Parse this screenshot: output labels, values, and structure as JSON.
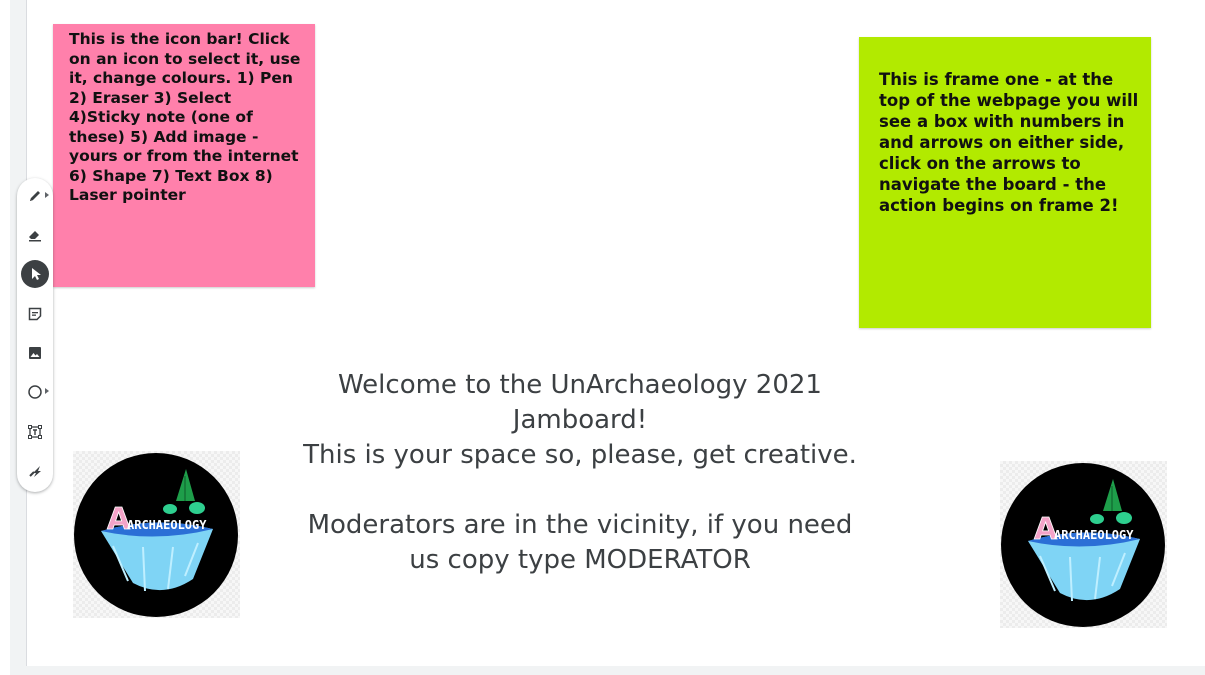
{
  "toolbar": {
    "tools": [
      {
        "name": "pen",
        "icon": "pen-icon"
      },
      {
        "name": "eraser",
        "icon": "eraser-icon"
      },
      {
        "name": "select",
        "icon": "select-cursor-icon",
        "active": true
      },
      {
        "name": "sticky-note",
        "icon": "sticky-note-icon"
      },
      {
        "name": "add-image",
        "icon": "image-icon"
      },
      {
        "name": "shape",
        "icon": "circle-shape-icon"
      },
      {
        "name": "text-box",
        "icon": "text-box-icon"
      },
      {
        "name": "laser-pointer",
        "icon": "laser-pointer-icon"
      }
    ]
  },
  "notes": {
    "icon_bar": "This is the icon bar! Click on an icon to select it, use it, change colours. 1) Pen 2) Eraser 3) Select 4)Sticky note (one of these) 5) Add image - yours or from the internet 6) Shape 7) Text Box 8) Laser pointer",
    "frame_one": "This is frame one - at the top of the webpage you will see a box with numbers in and arrows on either side, click on the arrows to navigate the board - the action begins on frame 2!"
  },
  "welcome": {
    "line1": "Welcome to the UnArchaeology 2021",
    "line2": "Jamboard!",
    "line3": "This is your space so, please, get creative.",
    "line4": "Moderators are in the vicinity, if you need",
    "line5": "us copy type MODERATOR"
  },
  "logo": {
    "text": "ARCHAEOLOGY"
  },
  "colors": {
    "pink_note": "#ff80ab",
    "green_note": "#b2ea00",
    "active_tool": "#3c4043"
  }
}
